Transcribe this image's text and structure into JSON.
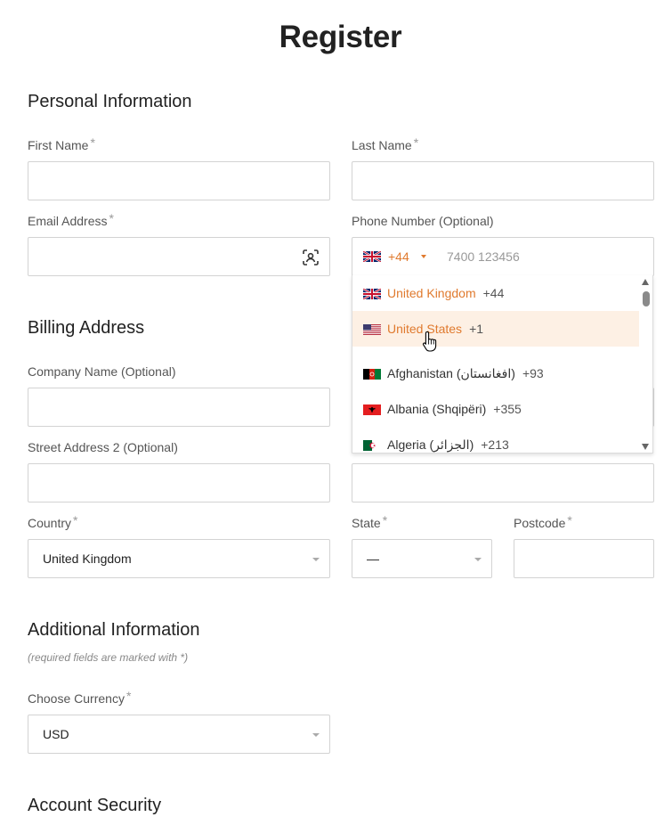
{
  "title": "Register",
  "required_mark": "*",
  "accent_color": "#e07a2e",
  "sections": {
    "personal": "Personal Information",
    "billing": "Billing Address",
    "additional": "Additional Information",
    "security": "Account Security"
  },
  "personal": {
    "first_name_label": "First Name",
    "last_name_label": "Last Name",
    "email_label": "Email Address",
    "email_icon": "contact-autofill-icon",
    "phone_label": "Phone Number (Optional)",
    "phone_code": "+44",
    "phone_placeholder": "7400 123456"
  },
  "billing": {
    "company_label": "Company Name (Optional)",
    "street2_label": "Street Address 2 (Optional)",
    "country_label": "Country",
    "country_value": "United Kingdom",
    "state_label": "State",
    "state_value": "—",
    "postcode_label": "Postcode"
  },
  "additional": {
    "note": "(required fields are marked with *)",
    "currency_label": "Choose Currency",
    "currency_value": "USD"
  },
  "phone_dropdown": {
    "options": [
      {
        "name": "United Kingdom",
        "code": "+44",
        "flag": "gb-flag"
      },
      {
        "name": "United States",
        "code": "+1",
        "flag": "us-flag"
      },
      {
        "name": "Afghanistan (‫افغانستان‬‎)",
        "code": "+93",
        "flag": "af-flag"
      },
      {
        "name": "Albania (Shqipëri)",
        "code": "+355",
        "flag": "al-flag"
      },
      {
        "name": "Algeria (‫الجزائر‬‎)",
        "code": "+213",
        "flag": "dz-flag"
      }
    ]
  }
}
